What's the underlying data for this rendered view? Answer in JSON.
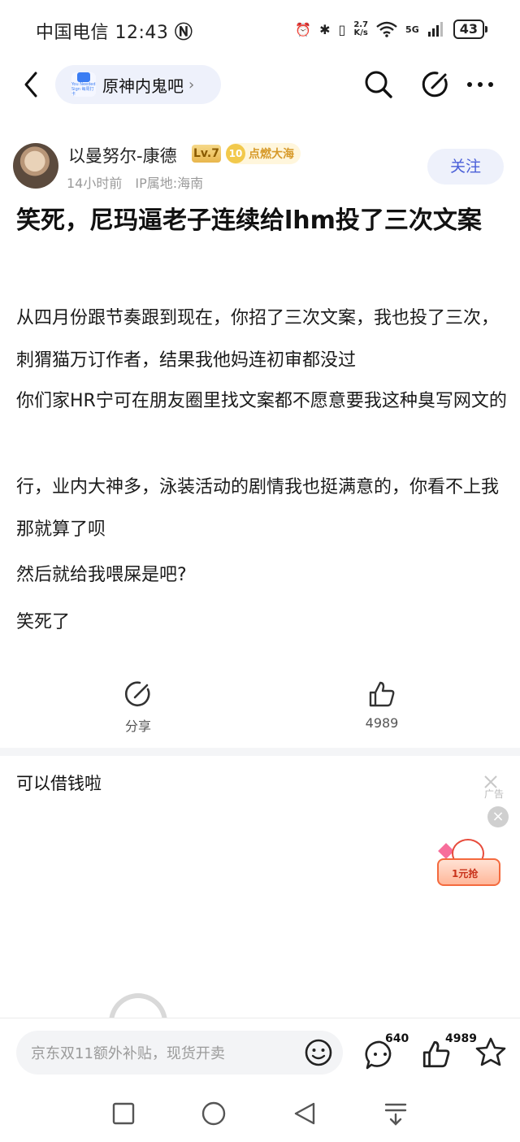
{
  "status_bar": {
    "carrier": "中国电信",
    "time": "12:43",
    "net_speed_top": "2.7",
    "net_speed_bottom": "K/s",
    "network": "5G",
    "battery": "43"
  },
  "nav": {
    "forum_name": "原神内鬼吧",
    "forum_logo_text": "You Needed Sign 每周打卡"
  },
  "author": {
    "name": "以曼努尔-康德",
    "level": "Lv.7",
    "medal_num": "10",
    "medal_label": "点燃大海",
    "time_ago": "14小时前",
    "ip": "IP属地:海南",
    "follow_label": "关注"
  },
  "post": {
    "title": "笑死，尼玛逼老子连续给lhm投了三次文案",
    "paragraphs": [
      "从四月份跟节奏跟到现在，你招了三次文案，我也投了三次，刺猬猫万订作者，结果我他妈连初审都没过",
      "你们家HR宁可在朋友圈里找文案都不愿意要我这种臭写网文的",
      "行，业内大神多，泳装活动的剧情我也挺满意的，你看不上我那就算了呗",
      "然后就给我喂屎是吧?",
      "笑死了"
    ]
  },
  "actions": {
    "share_label": "分享",
    "like_count": "4989"
  },
  "ad": {
    "title": "可以借钱啦",
    "tag": "广告",
    "promo_text": "1元抢"
  },
  "bottom_bar": {
    "input_placeholder": "京东双11额外补贴，现货开卖",
    "comment_count": "640",
    "like_count": "4989"
  },
  "colors": {
    "accent": "#4a5fd8",
    "pill_bg": "#eef1fb",
    "muted": "#9a9a9a"
  },
  "icons": [
    "back-icon",
    "search-icon",
    "edit-icon",
    "more-icon",
    "share-icon",
    "thumbs-up-icon",
    "emoji-icon",
    "comment-icon",
    "star-icon",
    "close-icon",
    "square-icon",
    "circle-icon",
    "triangle-icon",
    "menu-down-icon"
  ]
}
